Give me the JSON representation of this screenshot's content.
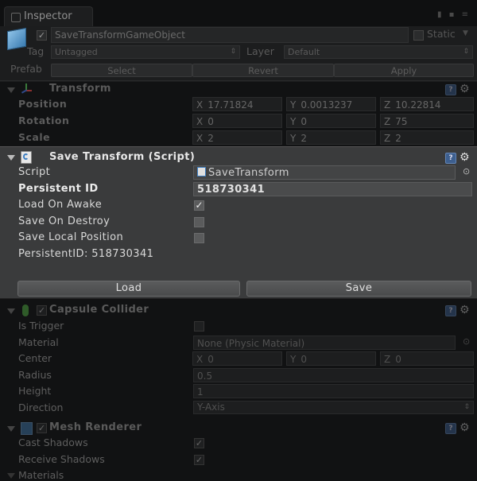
{
  "tab": {
    "label": "Inspector"
  },
  "object": {
    "name": "SaveTransformGameObject",
    "static_label": "Static",
    "tag_label": "Tag",
    "tag_value": "Untagged",
    "layer_label": "Layer",
    "layer_value": "Default",
    "prefab_label": "Prefab",
    "prefab_buttons": [
      "Select",
      "Revert",
      "Apply"
    ]
  },
  "transform": {
    "title": "Transform",
    "rows": [
      {
        "label": "Position",
        "x": "17.71824",
        "y": "0.0013237",
        "z": "10.22814"
      },
      {
        "label": "Rotation",
        "x": "0",
        "y": "0",
        "z": "75"
      },
      {
        "label": "Scale",
        "x": "2",
        "y": "2",
        "z": "2"
      }
    ]
  },
  "save_transform": {
    "title": "Save Transform (Script)",
    "script_label": "Script",
    "script_value": "SaveTransform",
    "persistent_id_label": "Persistent ID",
    "persistent_id_value": "518730341",
    "load_on_awake_label": "Load On Awake",
    "load_on_awake": true,
    "save_on_destroy_label": "Save On Destroy",
    "save_on_destroy": false,
    "save_local_position_label": "Save Local Position",
    "save_local_position": false,
    "info_text": "PersistentID: 518730341",
    "load_button": "Load",
    "save_button": "Save"
  },
  "capsule_collider": {
    "title": "Capsule Collider",
    "is_trigger_label": "Is Trigger",
    "material_label": "Material",
    "material_value": "None (Physic Material)",
    "center_label": "Center",
    "center": {
      "x": "0",
      "y": "0",
      "z": "0"
    },
    "radius_label": "Radius",
    "radius_value": "0.5",
    "height_label": "Height",
    "height_value": "1",
    "direction_label": "Direction",
    "direction_value": "Y-Axis"
  },
  "mesh_renderer": {
    "title": "Mesh Renderer",
    "cast_shadows_label": "Cast Shadows",
    "receive_shadows_label": "Receive Shadows",
    "materials_label": "Materials"
  },
  "axis_labels": {
    "x": "X",
    "y": "Y",
    "z": "Z"
  },
  "icons": {
    "check": "✓",
    "help": "?",
    "gear": "⚙",
    "dropdown": "⇕",
    "target": "⊙"
  }
}
